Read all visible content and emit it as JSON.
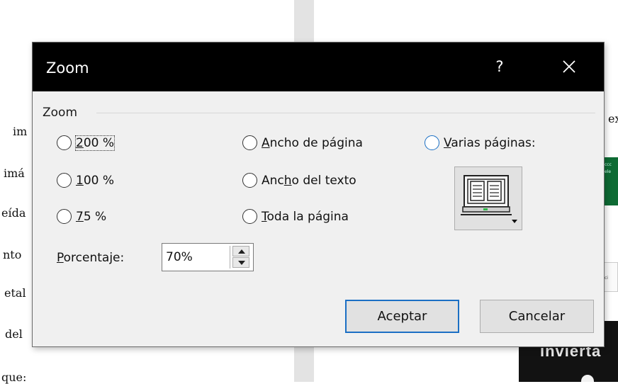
{
  "background": {
    "doc_words": [
      "im",
      "imá",
      "eída",
      "nto",
      "etal",
      "del",
      "que:"
    ],
    "right_fragment": "ex",
    "ad_green_lines": [
      "ccc",
      "ele"
    ],
    "ad_bar_text": "ci",
    "ad_black_text": "invierta"
  },
  "dialog": {
    "title": "Zoom",
    "help_label": "?",
    "group_label": "Zoom",
    "options_left": [
      {
        "label_pre": "",
        "accel": "2",
        "label_post": "00 %",
        "selected": false,
        "focused": true
      },
      {
        "label_pre": "",
        "accel": "1",
        "label_post": "00 %",
        "selected": false,
        "focused": false
      },
      {
        "label_pre": "",
        "accel": "7",
        "label_post": "5 %",
        "selected": false,
        "focused": false
      }
    ],
    "options_mid": [
      {
        "label_pre": "",
        "accel": "A",
        "label_post": "ncho de página"
      },
      {
        "label_pre": "Anc",
        "accel": "h",
        "label_post": "o del texto"
      },
      {
        "label_pre": "",
        "accel": "T",
        "label_post": "oda la página"
      }
    ],
    "option_right": {
      "label_pre": "",
      "accel": "V",
      "label_post": "arias páginas:"
    },
    "percent": {
      "label_pre": "",
      "accel": "P",
      "label_post": "orcentaje:",
      "value": "70%"
    },
    "ok_label": "Aceptar",
    "cancel_label": "Cancelar",
    "accent_color": "#1b6fc4"
  }
}
